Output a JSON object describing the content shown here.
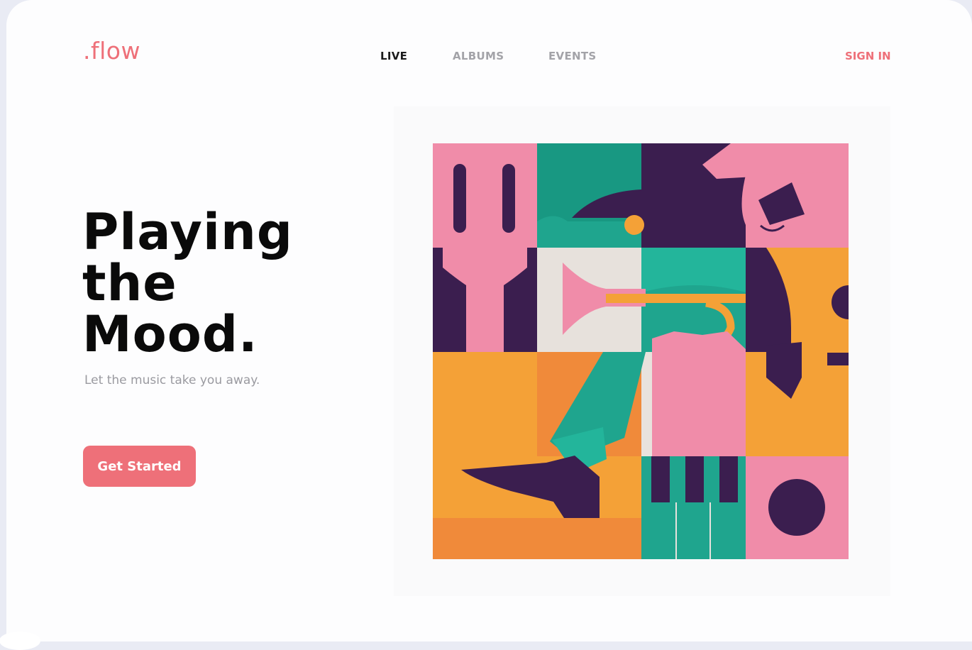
{
  "brand": {
    "logo": ".flow",
    "color": "#ee7079"
  },
  "nav": {
    "items": [
      {
        "label": "LIVE",
        "active": true
      },
      {
        "label": "ALBUMS",
        "active": false
      },
      {
        "label": "EVENTS",
        "active": false
      }
    ],
    "signin": "SIGN IN"
  },
  "hero": {
    "title_lines": [
      "Playing",
      "the",
      "Mood."
    ],
    "subtitle": "Let the music take you away.",
    "cta": "Get Started"
  },
  "illustration": {
    "icon": "jazz-musician-mosaic-illustration",
    "colors": {
      "pink": "#f08ca9",
      "teal": "#1fa58e",
      "purple": "#3b1e4f",
      "orange": "#f4a137",
      "cream": "#e8e2dd"
    }
  }
}
